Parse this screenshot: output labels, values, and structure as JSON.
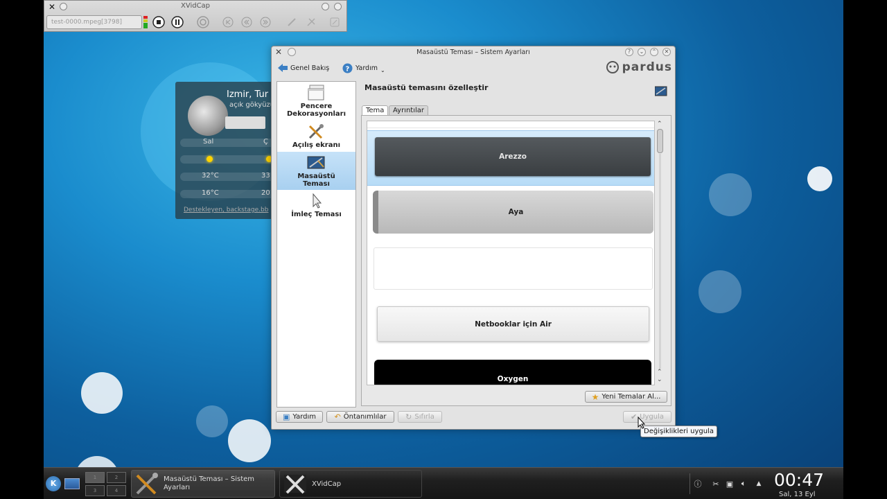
{
  "xvidcap": {
    "title": "XVidCap",
    "file": "test-0000.mpeg[3798]"
  },
  "weather": {
    "city": "Izmir, Tur",
    "condition": "açık gökyüzü",
    "day1": "Sal",
    "day2": "Ç",
    "high1": "32°C",
    "high2": "33",
    "low1": "16°C",
    "low2": "20",
    "credit": "Destekleyen, backstage.bb"
  },
  "dialog": {
    "title": "Masaüstü Teması – Sistem Ayarları",
    "back_label": "Genel Bakış",
    "help_label": "Yardım",
    "brand": "pardus",
    "heading": "Masaüstü temasını özelleştir",
    "tabs": [
      "Tema",
      "Ayrıntılar"
    ],
    "sidebar": [
      {
        "label1": "Pencere",
        "label2": "Dekorasyonları"
      },
      {
        "label1": "Açılış ekranı",
        "label2": ""
      },
      {
        "label1": "Masaüstü",
        "label2": "Teması"
      },
      {
        "label1": "İmleç Teması",
        "label2": ""
      }
    ],
    "themes": [
      "Arezzo",
      "Aya",
      "",
      "Netbooklar için Air",
      "Oxygen"
    ],
    "new_themes_button": "Yeni Temalar Al...",
    "help_button": "Yardım",
    "defaults_button": "Öntanımlılar",
    "reset_button": "Sıfırla",
    "apply_button": "Uygula",
    "tooltip": "Değişiklikleri uygula"
  },
  "taskbar": {
    "task1_line1": "Masaüstü Teması – Sistem",
    "task1_line2": "Ayarları",
    "task2": "XVidCap",
    "clock": "00:47",
    "date": "Sal, 13 Eyl"
  },
  "colors": {
    "selection": "#a8d0f0",
    "desktop": "#1a8ccd"
  }
}
